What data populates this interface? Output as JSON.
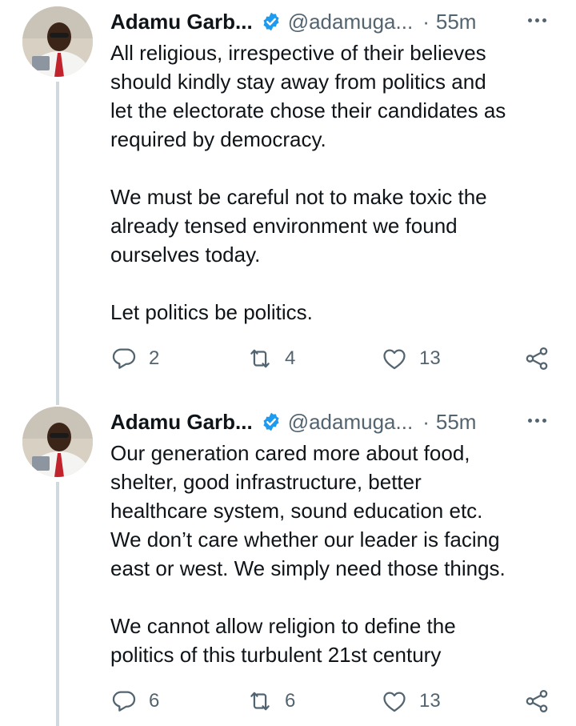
{
  "tweets": [
    {
      "name": "Adamu Garb...",
      "handle": "@adamuga...",
      "separator": "·",
      "time": "55m",
      "paragraphs": [
        "All religious, irrespective of their believes\nshould kindly stay away from politics and\nlet the electorate chose their candidates as\nrequired by democracy.",
        "We must be careful not to make toxic the\nalready tensed environment we found\nourselves today.",
        "Let politics be politics."
      ],
      "replies": "2",
      "retweets": "4",
      "likes": "13"
    },
    {
      "name": "Adamu Garb...",
      "handle": "@adamuga...",
      "separator": "·",
      "time": "55m",
      "paragraphs": [
        "Our generation cared more about food,\nshelter, good infrastructure, better\nhealthcare system, sound education etc.\nWe don’t care whether our leader is facing\neast or west. We simply need those things.",
        "We cannot allow religion to define the\npolitics of this turbulent 21st century"
      ],
      "replies": "6",
      "retweets": "6",
      "likes": "13"
    }
  ],
  "icons": {
    "verified": "verified-badge-icon",
    "more": "more-dots-icon",
    "reply": "reply-icon",
    "retweet": "retweet-icon",
    "like": "heart-icon",
    "share": "share-icon"
  },
  "colors": {
    "verified": "#1d9bf0",
    "muted": "#536471",
    "text": "#0f1419",
    "thread_line": "#cfd9de"
  }
}
